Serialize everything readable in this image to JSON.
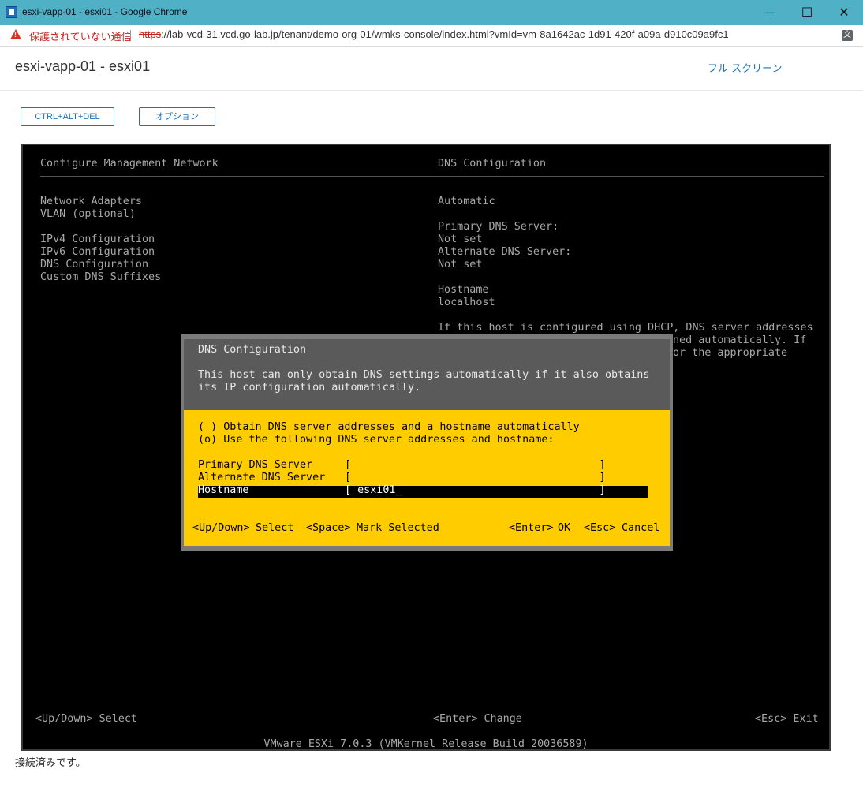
{
  "window": {
    "title": "esxi-vapp-01 - esxi01 - Google Chrome",
    "minimize": "—",
    "maximize": "☐",
    "close": "✕"
  },
  "addressbar": {
    "security_text": "保護されていない通信",
    "url_scheme": "https",
    "url_rest": "://lab-vcd-31.vcd.go-lab.jp/tenant/demo-org-01/wmks-console/index.html?vmId=vm-8a1642ac-1d91-420f-a09a-d910c09a9fc1",
    "translate_icon": "translate-icon"
  },
  "page": {
    "title": "esxi-vapp-01 - esxi01",
    "fullscreen_label": "フル スクリーン",
    "ctrl_alt_del_label": "CTRL+ALT+DEL",
    "options_label": "オプション",
    "status_text": "接続済みです。"
  },
  "console": {
    "left_header": "Configure Management Network",
    "right_header": "DNS Configuration",
    "menu": [
      "Network Adapters",
      "VLAN (optional)",
      "IPv4 Configuration",
      "IPv6 Configuration",
      "DNS Configuration",
      "Custom DNS Suffixes"
    ],
    "right_lines": {
      "automatic": "Automatic",
      "primary_label": "Primary DNS Server:",
      "primary_value": "Not set",
      "alternate_label": "Alternate DNS Server:",
      "alternate_value": "Not set",
      "hostname_label": "Hostname",
      "hostname_value": "localhost",
      "dhcp_line1": "If this host is configured using DHCP, DNS server addresses",
      "dhcp_line2_tail": "ned automatically. If",
      "dhcp_line3_tail": "or the appropriate"
    },
    "footer_left": "<Up/Down> Select",
    "footer_center": "<Enter> Change",
    "footer_right": "<Esc> Exit",
    "version": "VMware ESXi 7.0.3 (VMKernel Release Build 20036589)"
  },
  "dialog": {
    "title": "DNS Configuration",
    "desc_line1": "This host can only obtain DNS settings automatically if it also obtains",
    "desc_line2": "its IP configuration automatically.",
    "option_auto": "( ) Obtain DNS server addresses and a hostname automatically",
    "option_manual": "(o) Use the following DNS server addresses and hostname:",
    "fields": {
      "primary_label": "Primary DNS Server",
      "primary_value": "[                                       ]",
      "alternate_label": "Alternate DNS Server",
      "alternate_value": "[                                       ]",
      "hostname_label": "Hostname",
      "hostname_value": "[ esxi01_                               ]"
    },
    "keys": {
      "updown": "<Up/Down>",
      "select": "Select",
      "space": "<Space>",
      "mark": "Mark Selected",
      "enter": "<Enter>",
      "ok": "OK",
      "esc": "<Esc>",
      "cancel": "Cancel"
    }
  }
}
